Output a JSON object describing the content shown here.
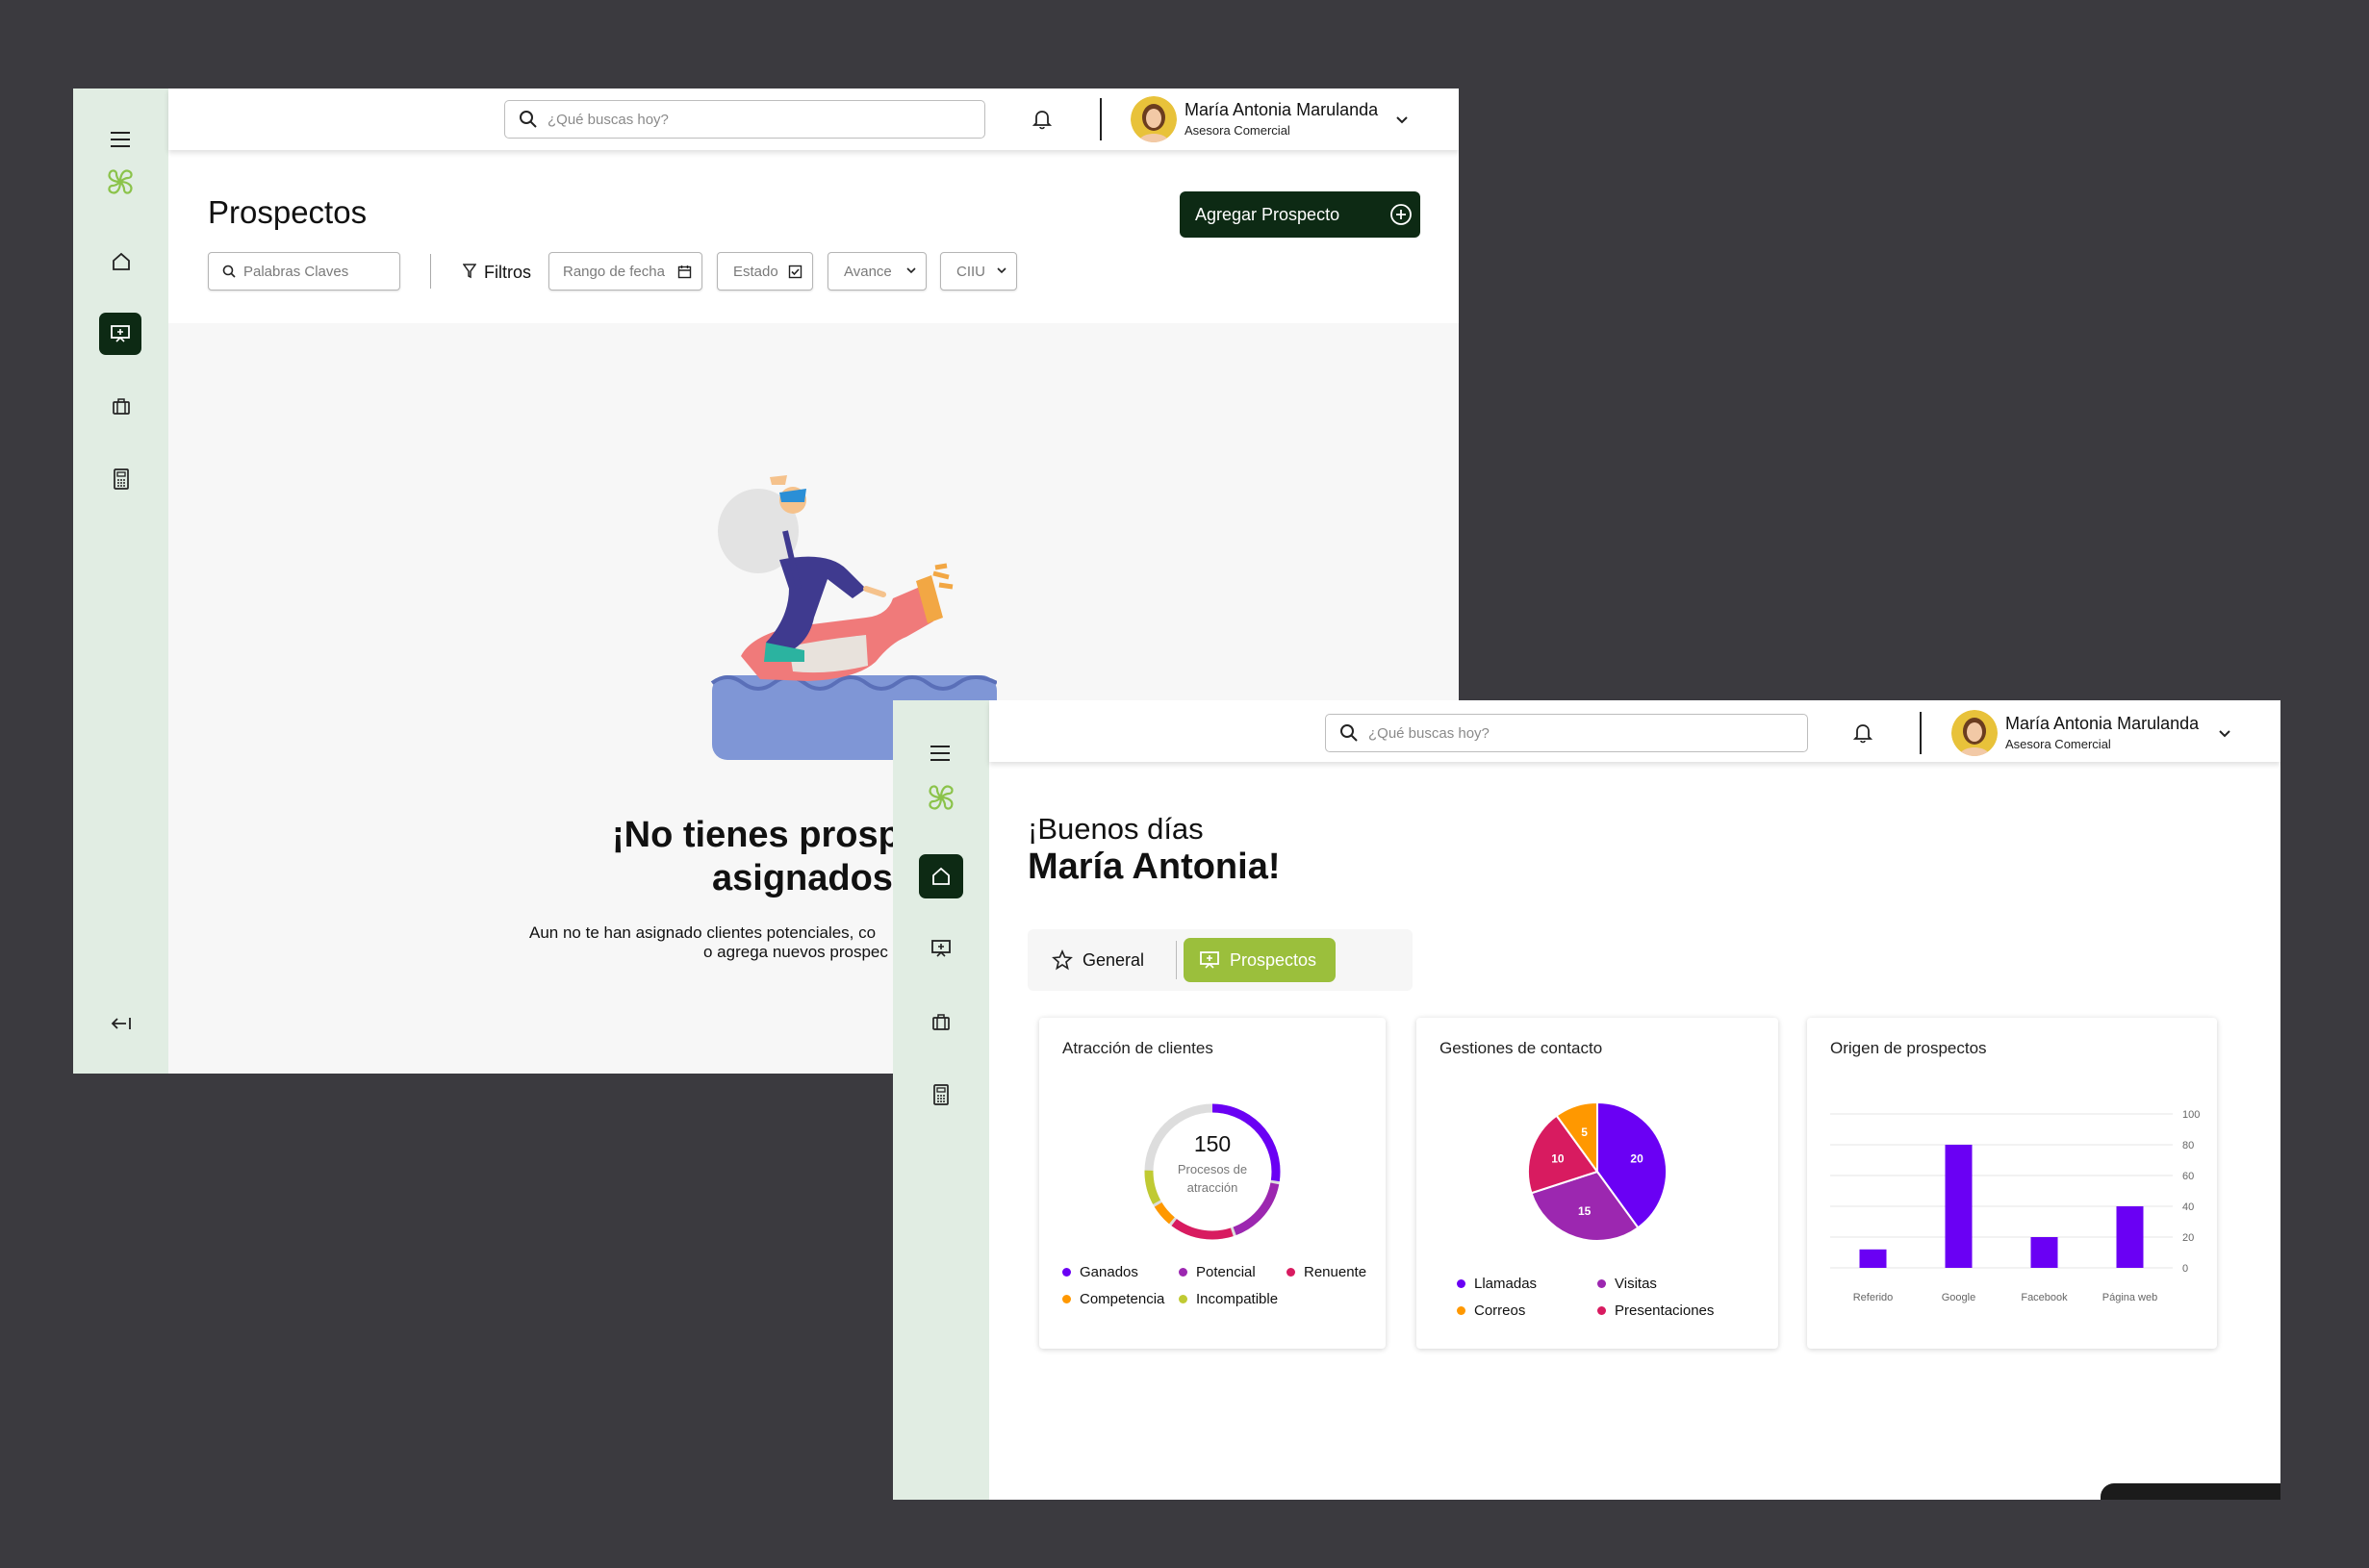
{
  "colors": {
    "accent_dark": "#0d2a14",
    "accent_lime": "#9bbf3c",
    "sidebar_bg": "#e1ede3",
    "purple": "#6a00f4",
    "violet": "#9c27b0",
    "magenta": "#d81b60",
    "orange": "#ff9800",
    "lime": "#c0ca33",
    "grey_ring": "#dddddd"
  },
  "header": {
    "search_placeholder": "¿Qué buscas hoy?",
    "user_name": "María Antonia Marulanda",
    "user_role": "Asesora Comercial",
    "bell_icon": "bell-icon",
    "chevron_icon": "chevron-down-icon"
  },
  "sidebar": {
    "items": [
      {
        "icon": "home-icon",
        "label": "Inicio"
      },
      {
        "icon": "presentation-icon",
        "label": "Prospectos"
      },
      {
        "icon": "briefcase-icon",
        "label": "Portafolio"
      },
      {
        "icon": "calculator-icon",
        "label": "Calculadora"
      }
    ],
    "menu_icon": "hamburger-icon",
    "logo_icon": "clover-logo-icon",
    "collapse_icon": "collapse-left-icon"
  },
  "prospectos": {
    "title": "Prospectos",
    "add_button": "Agregar Prospecto",
    "keywords_placeholder": "Palabras Claves",
    "filters_label": "Filtros",
    "filter_date": "Rango de fecha",
    "filter_state": "Estado",
    "filter_progress": "Avance",
    "filter_ciiu": "CIIU",
    "empty_title_line1": "¡No tienes prosp",
    "empty_title_line2": "asignados",
    "empty_text_line1": "Aun no te han asignado clientes potenciales, co",
    "empty_text_line2": "o agrega  nuevos prospec"
  },
  "dashboard": {
    "greeting": "¡Buenos días",
    "name": "María Antonia!",
    "tabs": [
      {
        "label": "General",
        "icon": "star-icon",
        "active": false
      },
      {
        "label": "Prospectos",
        "icon": "presentation-icon",
        "active": true
      }
    ],
    "cards": {
      "attraction": {
        "title": "Atracción de clientes",
        "center_value": "150",
        "center_label_line1": "Procesos de",
        "center_label_line2": "atracción",
        "legend": [
          {
            "label": "Ganados",
            "color": "#6a00f4"
          },
          {
            "label": "Potencial",
            "color": "#9c27b0"
          },
          {
            "label": "Renuente",
            "color": "#d81b60"
          },
          {
            "label": "Competencia",
            "color": "#ff9800"
          },
          {
            "label": "Incompatible",
            "color": "#c0ca33"
          }
        ]
      },
      "contact": {
        "title": "Gestiones de contacto",
        "legend": [
          {
            "label": "Llamadas",
            "color": "#6a00f4"
          },
          {
            "label": "Visitas",
            "color": "#9c27b0"
          },
          {
            "label": "Correos",
            "color": "#ff9800"
          },
          {
            "label": "Presentaciones",
            "color": "#d81b60"
          }
        ]
      },
      "origin": {
        "title": "Origen de prospectos"
      }
    }
  },
  "chart_data": [
    {
      "type": "pie",
      "variant": "donut",
      "title": "Atracción de clientes",
      "center_text": "150",
      "series": [
        {
          "name": "Ganados",
          "fraction": 0.28
        },
        {
          "name": "Potencial",
          "fraction": 0.17
        },
        {
          "name": "Renuente",
          "fraction": 0.16
        },
        {
          "name": "Competencia",
          "fraction": 0.06
        },
        {
          "name": "Incompatible",
          "fraction": 0.09
        }
      ],
      "remaining_fraction": 0.24
    },
    {
      "type": "pie",
      "title": "Gestiones de contacto",
      "labels": [
        "Llamadas",
        "Visitas",
        "Presentaciones",
        "Correos"
      ],
      "values": [
        20,
        15,
        10,
        5
      ]
    },
    {
      "type": "bar",
      "title": "Origen de prospectos",
      "categories": [
        "Referido",
        "Google",
        "Facebook",
        "Página web"
      ],
      "values": [
        12,
        80,
        20,
        40
      ],
      "ylim": [
        0,
        100
      ],
      "yticks": [
        "100",
        "80",
        "60",
        "40",
        "20",
        "0"
      ],
      "grid": true
    }
  ]
}
